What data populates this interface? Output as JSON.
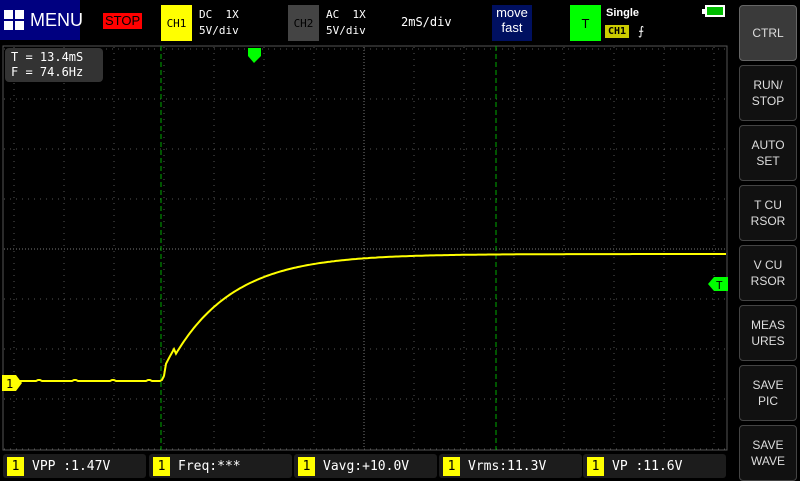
{
  "header": {
    "menu_label": "MENU",
    "run_state": "STOP",
    "ch1": {
      "label": "CH1",
      "coupling": "DC  1X",
      "scale": "5V/div"
    },
    "ch2": {
      "label": "CH2",
      "coupling": "AC  1X",
      "scale": "5V/div"
    },
    "timebase": "2mS/div",
    "move_mode": "move\nfast",
    "trigger": {
      "label": "T",
      "mode": "Single",
      "source": "CH1",
      "edge": "⨍"
    },
    "battery_level": 1.0
  },
  "cursor_readout": {
    "text": "T = 13.4mS\nF = 74.6Hz"
  },
  "markers": {
    "ch1": "1",
    "trigger_level": "T"
  },
  "side_buttons": [
    {
      "label": "CTRL"
    },
    {
      "label": "RUN/\nSTOP"
    },
    {
      "label": "AUTO\nSET"
    },
    {
      "label": "T CU\nRSOR"
    },
    {
      "label": "V CU\nRSOR"
    },
    {
      "label": "MEAS\nURES"
    },
    {
      "label": "SAVE\nPIC"
    },
    {
      "label": "SAVE\nWAVE"
    }
  ],
  "measurements": [
    {
      "ch": "1",
      "text": "VPP :1.47V"
    },
    {
      "ch": "1",
      "text": "Freq:***"
    },
    {
      "ch": "1",
      "text": "Vavg:+10.0V"
    },
    {
      "ch": "1",
      "text": "Vrms:11.3V"
    },
    {
      "ch": "1",
      "text": "VP  :11.6V"
    }
  ],
  "colors": {
    "ch1": "#ffff00",
    "trigger": "#00ff00",
    "cursor": "#00aa00"
  }
}
